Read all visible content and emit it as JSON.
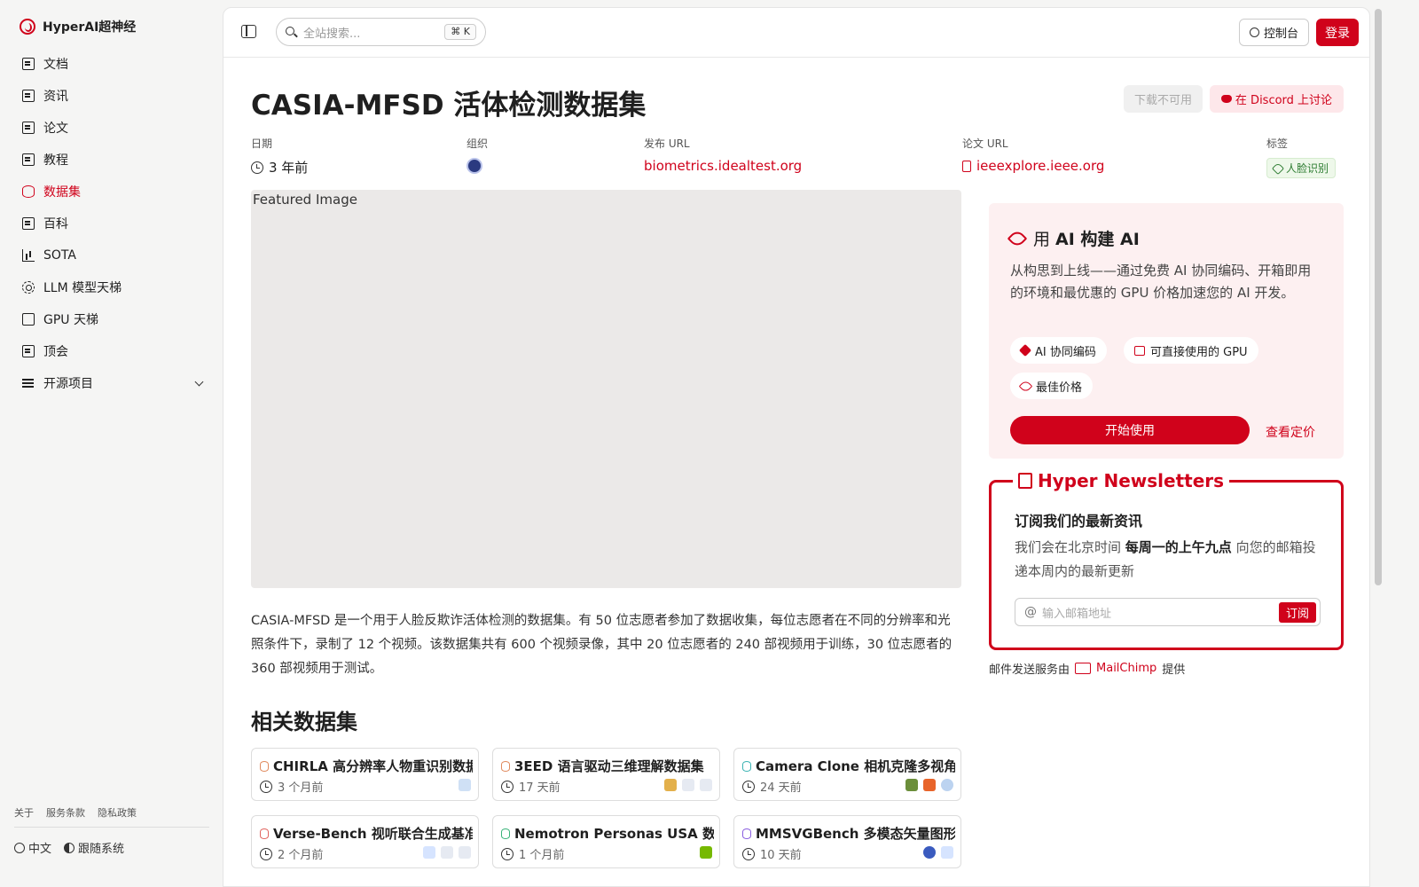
{
  "sidebar": {
    "brand": "HyperAI超神经",
    "items": [
      {
        "label": "文档",
        "icon": "doc-icon"
      },
      {
        "label": "资讯",
        "icon": "newspaper-icon"
      },
      {
        "label": "论文",
        "icon": "paper-icon"
      },
      {
        "label": "教程",
        "icon": "book-icon"
      },
      {
        "label": "数据集",
        "icon": "database-icon",
        "active": true
      },
      {
        "label": "百科",
        "icon": "wiki-icon"
      },
      {
        "label": "SOTA",
        "icon": "bar-chart-icon"
      },
      {
        "label": "LLM 模型天梯",
        "icon": "cpu-icon"
      },
      {
        "label": "GPU 天梯",
        "icon": "monitor-icon"
      },
      {
        "label": "顶会",
        "icon": "conference-icon"
      },
      {
        "label": "开源项目",
        "icon": "list-icon"
      }
    ],
    "footer_links": [
      "关于",
      "服务条款",
      "隐私政策"
    ],
    "language": "中文",
    "theme": "跟随系统"
  },
  "topbar": {
    "search_placeholder": "全站搜索...",
    "shortcut": "⌘ K",
    "console": "控制台",
    "login": "登录"
  },
  "dataset": {
    "title": "CASIA-MFSD 活体检测数据集",
    "download": "下载不可用",
    "discord": "在 Discord 上讨论",
    "meta": {
      "date_label": "日期",
      "date_value": "3 年前",
      "org_label": "组织",
      "release_label": "发布 URL",
      "release_value": "biometrics.idealtest.org",
      "paper_label": "论文 URL",
      "paper_value": "ieeexplore.ieee.org",
      "tags_label": "标签",
      "tag": "人脸识别"
    },
    "featured_alt": "Featured Image",
    "description": "CASIA-MFSD 是一个用于人脸反欺诈活体检测的数据集。有 50 位志愿者参加了数据收集，每位志愿者在不同的分辨率和光照条件下，录制了 12 个视频。该数据集共有 600 个视频录像，其中 20 位志愿者的 240 部视频用于训练，30 位志愿者的 360 部视频用于测试。"
  },
  "related": {
    "title": "相关数据集",
    "cards": [
      {
        "title": "CHIRLA 高分辨率人物重识别数据集",
        "date": "3 个月前"
      },
      {
        "title": "3EED 语言驱动三维理解数据集",
        "date": "17 天前"
      },
      {
        "title": "Camera Clone 相机克隆多视角数据集",
        "date": "24 天前"
      },
      {
        "title": "Verse-Bench 视听联合生成基准",
        "date": "2 个月前"
      },
      {
        "title": "Nemotron Personas USA 数据集",
        "date": "1 个月前"
      },
      {
        "title": "MMSVGBench 多模态矢量图形基准",
        "date": "10 天前"
      }
    ]
  },
  "promo": {
    "title_prefix": "用 ",
    "title_bold": "AI 构建 AI",
    "desc": "从构思到上线——通过免费 AI 协同编码、开箱即用的环境和最优惠的 GPU 价格加速您的 AI 开发。",
    "chip1": "AI 协同编码",
    "chip2": "可直接使用的 GPU",
    "chip3": "最佳价格",
    "start": "开始使用",
    "pricing": "查看定价"
  },
  "newsletter": {
    "legend": "Hyper Newsletters",
    "heading": "订阅我们的最新资讯",
    "p1": "我们会在北京时间 ",
    "p_bold": "每周一的上午九点",
    "p2": " 向您的邮箱投递本周内的最新更新",
    "email_placeholder": "输入邮箱地址",
    "subscribe": "订阅",
    "provider_prefix": "邮件发送服务由",
    "provider": "MailChimp",
    "provider_suffix": "提供"
  },
  "colors": {
    "accent": "#d0021b",
    "tag_green": "#2e7d32"
  }
}
